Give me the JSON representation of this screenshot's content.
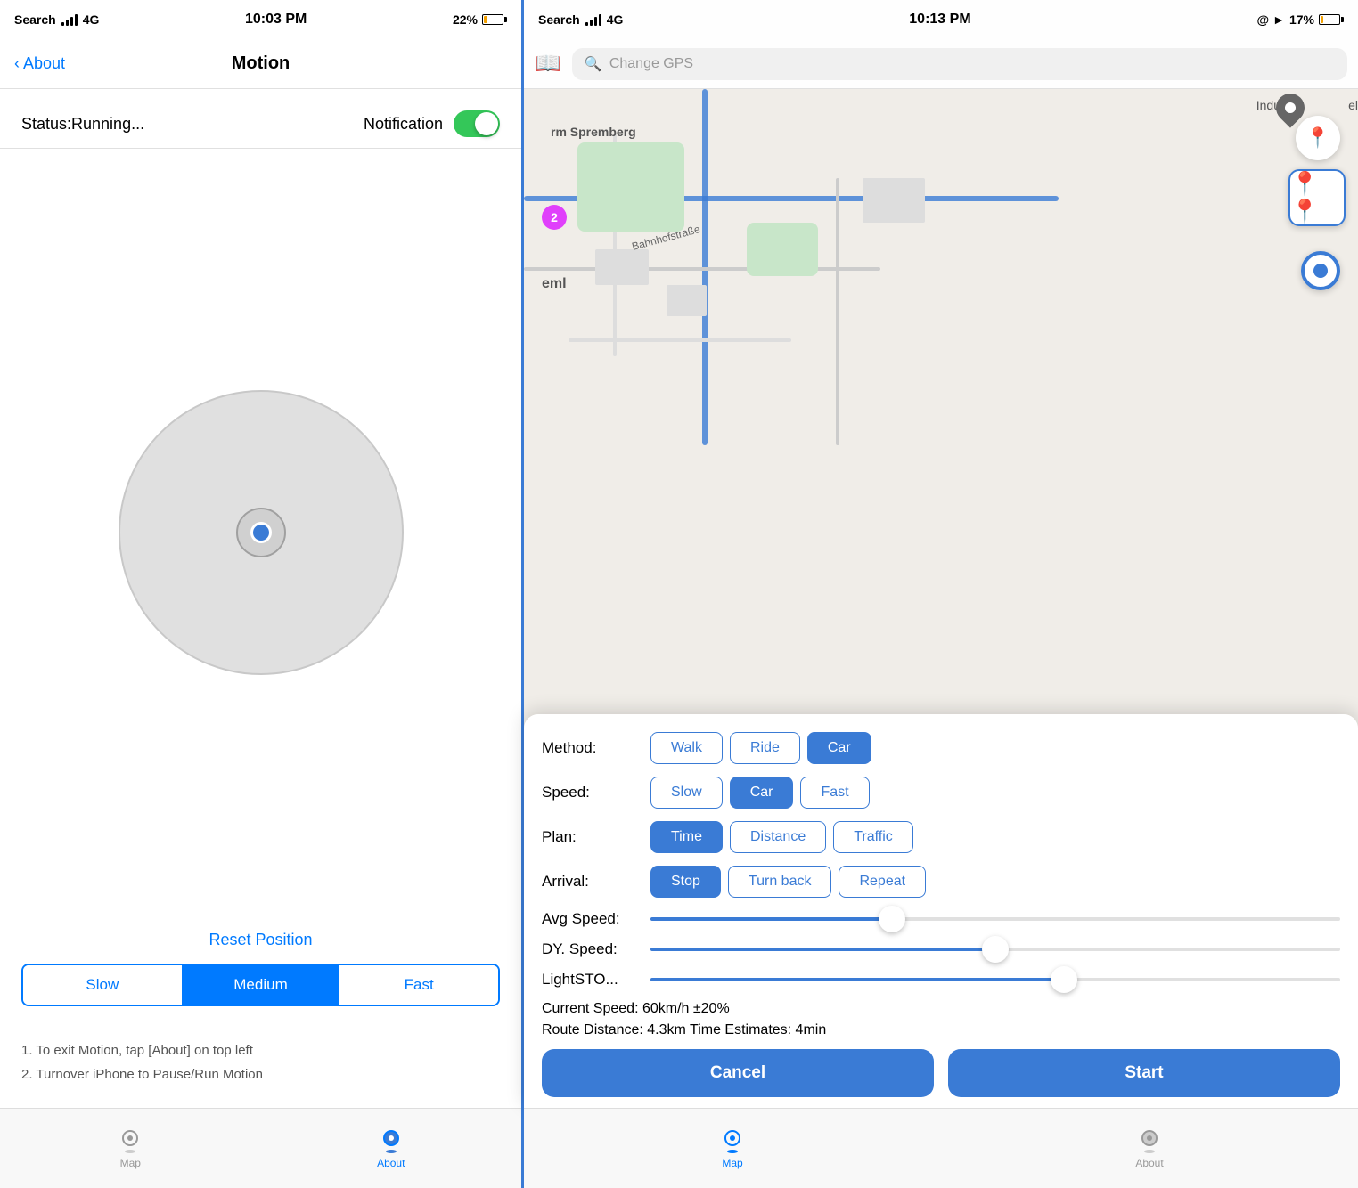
{
  "left": {
    "statusBar": {
      "carrier": "Search",
      "signal": "4G",
      "time": "10:03 PM",
      "battery": "22%"
    },
    "navBar": {
      "backLabel": "About",
      "title": "Motion"
    },
    "status": {
      "text": "Status:Running...",
      "notificationLabel": "Notification"
    },
    "joystick": {
      "resetLabel": "Reset Position"
    },
    "speed": {
      "options": [
        "Slow",
        "Medium",
        "Fast"
      ],
      "active": "Medium"
    },
    "instructions": {
      "line1": "1. To exit Motion, tap [About] on top left",
      "line2": "2. Turnover iPhone to Pause/Run Motion"
    },
    "tabs": {
      "map": "Map",
      "about": "About"
    }
  },
  "right": {
    "statusBar": {
      "carrier": "Search",
      "signal": "4G",
      "time": "10:13 PM",
      "battery": "17%"
    },
    "search": {
      "placeholder": "Change GPS"
    },
    "map": {
      "label": "Map area"
    },
    "controls": {
      "method": {
        "label": "Method:",
        "options": [
          "Walk",
          "Ride",
          "Car"
        ],
        "active": "Car"
      },
      "speed": {
        "label": "Speed:",
        "options": [
          "Slow",
          "Car",
          "Fast"
        ],
        "active": "Car"
      },
      "plan": {
        "label": "Plan:",
        "options": [
          "Time",
          "Distance",
          "Traffic"
        ],
        "active": "Time"
      },
      "arrival": {
        "label": "Arrival:",
        "options": [
          "Stop",
          "Turn back",
          "Repeat"
        ],
        "active": "Stop"
      },
      "avgSpeed": {
        "label": "Avg Speed:",
        "value": 0.35
      },
      "dySpeed": {
        "label": "DY. Speed:",
        "value": 0.5
      },
      "lightSto": {
        "label": "LightSTO...",
        "value": 0.6
      },
      "currentSpeed": "Current Speed: 60km/h ±20%",
      "routeDistance": "Route Distance: 4.3km",
      "timeEstimate": "Time Estimates:   4min",
      "cancelLabel": "Cancel",
      "startLabel": "Start"
    },
    "tabs": {
      "map": "Map",
      "about": "About"
    }
  }
}
